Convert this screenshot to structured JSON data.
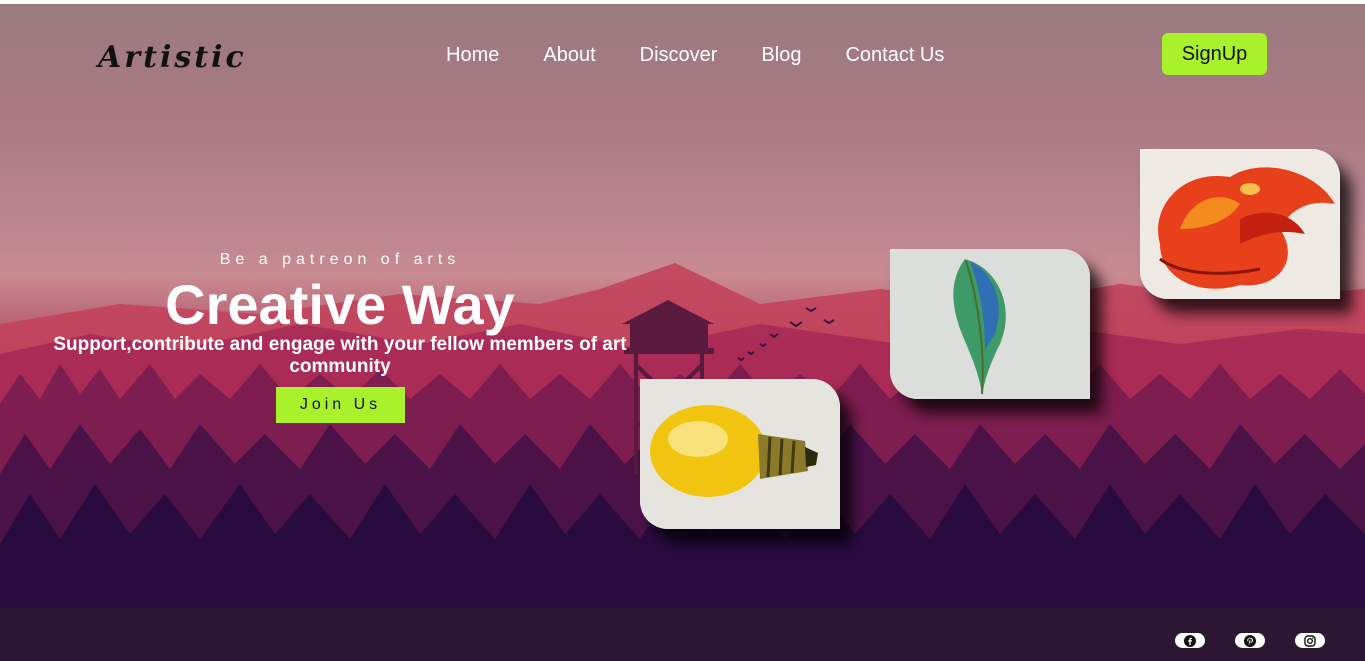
{
  "header": {
    "logo": "Artistic",
    "nav": [
      "Home",
      "About",
      "Discover",
      "Blog",
      "Contact Us"
    ],
    "signup_label": "SignUp"
  },
  "hero": {
    "tagline": "Be a patreon of arts",
    "headline": "Creative Way",
    "subline": "Support,contribute and engage with your fellow members of art community",
    "cta_label": "Join Us"
  },
  "gallery": [
    {
      "name": "ganesha-painting"
    },
    {
      "name": "feather-painting"
    },
    {
      "name": "lightbulb-painting"
    }
  ],
  "footer": {
    "social_icons": [
      "facebook-icon",
      "pinterest-icon",
      "instagram-icon"
    ]
  },
  "colors": {
    "accent": "#a9f22b",
    "footer_bg": "#2c1733",
    "hero_top": "#9b7a80",
    "hero_bottom": "#22083d"
  }
}
